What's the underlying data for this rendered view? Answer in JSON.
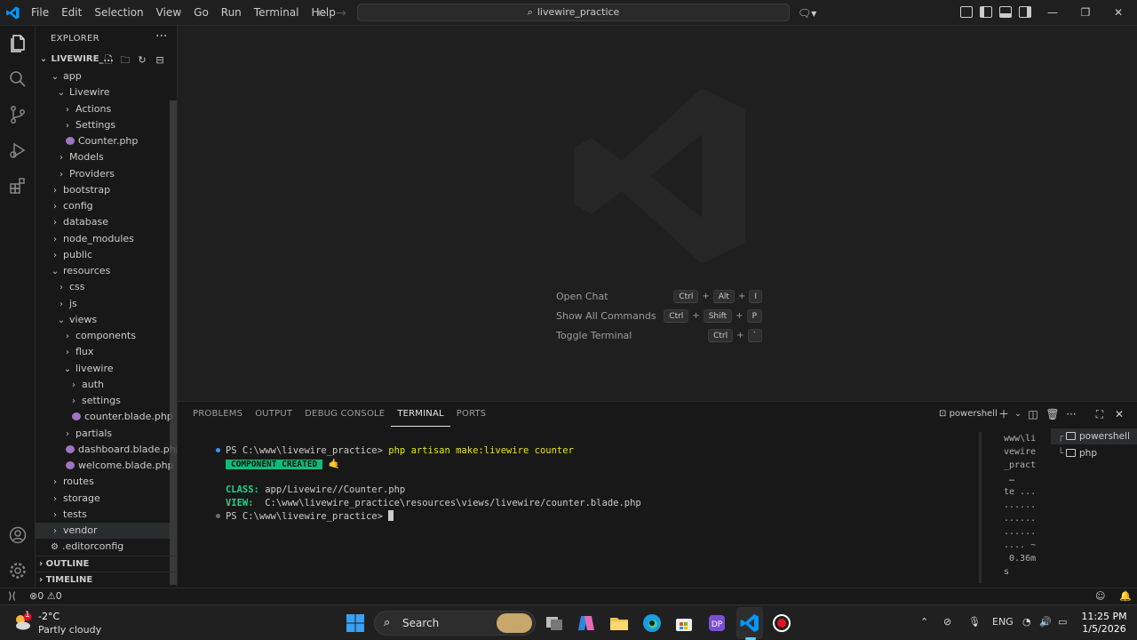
{
  "window": {
    "title": "livewire_practice"
  },
  "menu": [
    "File",
    "Edit",
    "Selection",
    "View",
    "Go",
    "Run",
    "Terminal",
    "Help"
  ],
  "explorer": {
    "header": "EXPLORER",
    "root": "LIVEWIRE_...",
    "tree": [
      {
        "label": "app",
        "depth": 1,
        "kind": "open"
      },
      {
        "label": "Livewire",
        "depth": 2,
        "kind": "open"
      },
      {
        "label": "Actions",
        "depth": 3,
        "kind": "closed"
      },
      {
        "label": "Settings",
        "depth": 3,
        "kind": "closed"
      },
      {
        "label": "Counter.php",
        "depth": 3,
        "kind": "php"
      },
      {
        "label": "Models",
        "depth": 2,
        "kind": "closed"
      },
      {
        "label": "Providers",
        "depth": 2,
        "kind": "closed"
      },
      {
        "label": "bootstrap",
        "depth": 1,
        "kind": "closed"
      },
      {
        "label": "config",
        "depth": 1,
        "kind": "closed"
      },
      {
        "label": "database",
        "depth": 1,
        "kind": "closed"
      },
      {
        "label": "node_modules",
        "depth": 1,
        "kind": "closed"
      },
      {
        "label": "public",
        "depth": 1,
        "kind": "closed"
      },
      {
        "label": "resources",
        "depth": 1,
        "kind": "open"
      },
      {
        "label": "css",
        "depth": 2,
        "kind": "closed"
      },
      {
        "label": "js",
        "depth": 2,
        "kind": "closed"
      },
      {
        "label": "views",
        "depth": 2,
        "kind": "open"
      },
      {
        "label": "components",
        "depth": 3,
        "kind": "closed"
      },
      {
        "label": "flux",
        "depth": 3,
        "kind": "closed"
      },
      {
        "label": "livewire",
        "depth": 3,
        "kind": "open"
      },
      {
        "label": "auth",
        "depth": 4,
        "kind": "closed"
      },
      {
        "label": "settings",
        "depth": 4,
        "kind": "closed"
      },
      {
        "label": "counter.blade.php",
        "depth": 4,
        "kind": "php"
      },
      {
        "label": "partials",
        "depth": 3,
        "kind": "closed"
      },
      {
        "label": "dashboard.blade.php",
        "depth": 3,
        "kind": "php"
      },
      {
        "label": "welcome.blade.php",
        "depth": 3,
        "kind": "php"
      },
      {
        "label": "routes",
        "depth": 1,
        "kind": "closed"
      },
      {
        "label": "storage",
        "depth": 1,
        "kind": "closed"
      },
      {
        "label": "tests",
        "depth": 1,
        "kind": "closed"
      },
      {
        "label": "vendor",
        "depth": 1,
        "kind": "closed",
        "selected": true
      },
      {
        "label": ".editorconfig",
        "depth": 1,
        "kind": "gear"
      }
    ],
    "outline": "OUTLINE",
    "timeline": "TIMELINE"
  },
  "editor": {
    "hints": [
      {
        "label": "Open Chat",
        "keys": [
          "Ctrl",
          "Alt",
          "I"
        ]
      },
      {
        "label": "Show All Commands",
        "keys": [
          "Ctrl",
          "Shift",
          "P"
        ]
      },
      {
        "label": "Toggle Terminal",
        "keys": [
          "Ctrl",
          "`"
        ]
      }
    ]
  },
  "panel": {
    "tabs": [
      "PROBLEMS",
      "OUTPUT",
      "DEBUG CONSOLE",
      "TERMINAL",
      "PORTS"
    ],
    "active_tab": "TERMINAL",
    "terminal_name": "powershell",
    "prompt": "PS C:\\www\\livewire_practice>",
    "command": "php artisan make:livewire counter",
    "badge": "COMPONENT CREATED",
    "emoji": "🤙",
    "class_label": "CLASS:",
    "class_value": "app/Livewire//Counter.php",
    "view_label": "VIEW:",
    "view_value": "C:\\www\\livewire_practice\\resources\\views/livewire/counter.blade.php",
    "prompt2": "PS C:\\www\\livewire_practice>",
    "side_text": "www\\li\nvewire\n_pract\n …\nte ...\n......\n......\n......\n.... ~\n 0.36m\ns",
    "terminals": [
      {
        "name": "powershell",
        "prefix": "┌"
      },
      {
        "name": "php",
        "prefix": "└"
      }
    ]
  },
  "statusbar": {
    "errors": "0",
    "warnings": "0"
  },
  "taskbar": {
    "temp": "-2°C",
    "condition": "Partly cloudy",
    "weather_badge": "1",
    "search": "Search",
    "lang": "ENG",
    "time": "11:25 PM",
    "date": "1/5/2026"
  },
  "colors": {
    "accent": "#0078d4",
    "badge_green": "#0dbc79",
    "php_icon": "#a074c4"
  }
}
